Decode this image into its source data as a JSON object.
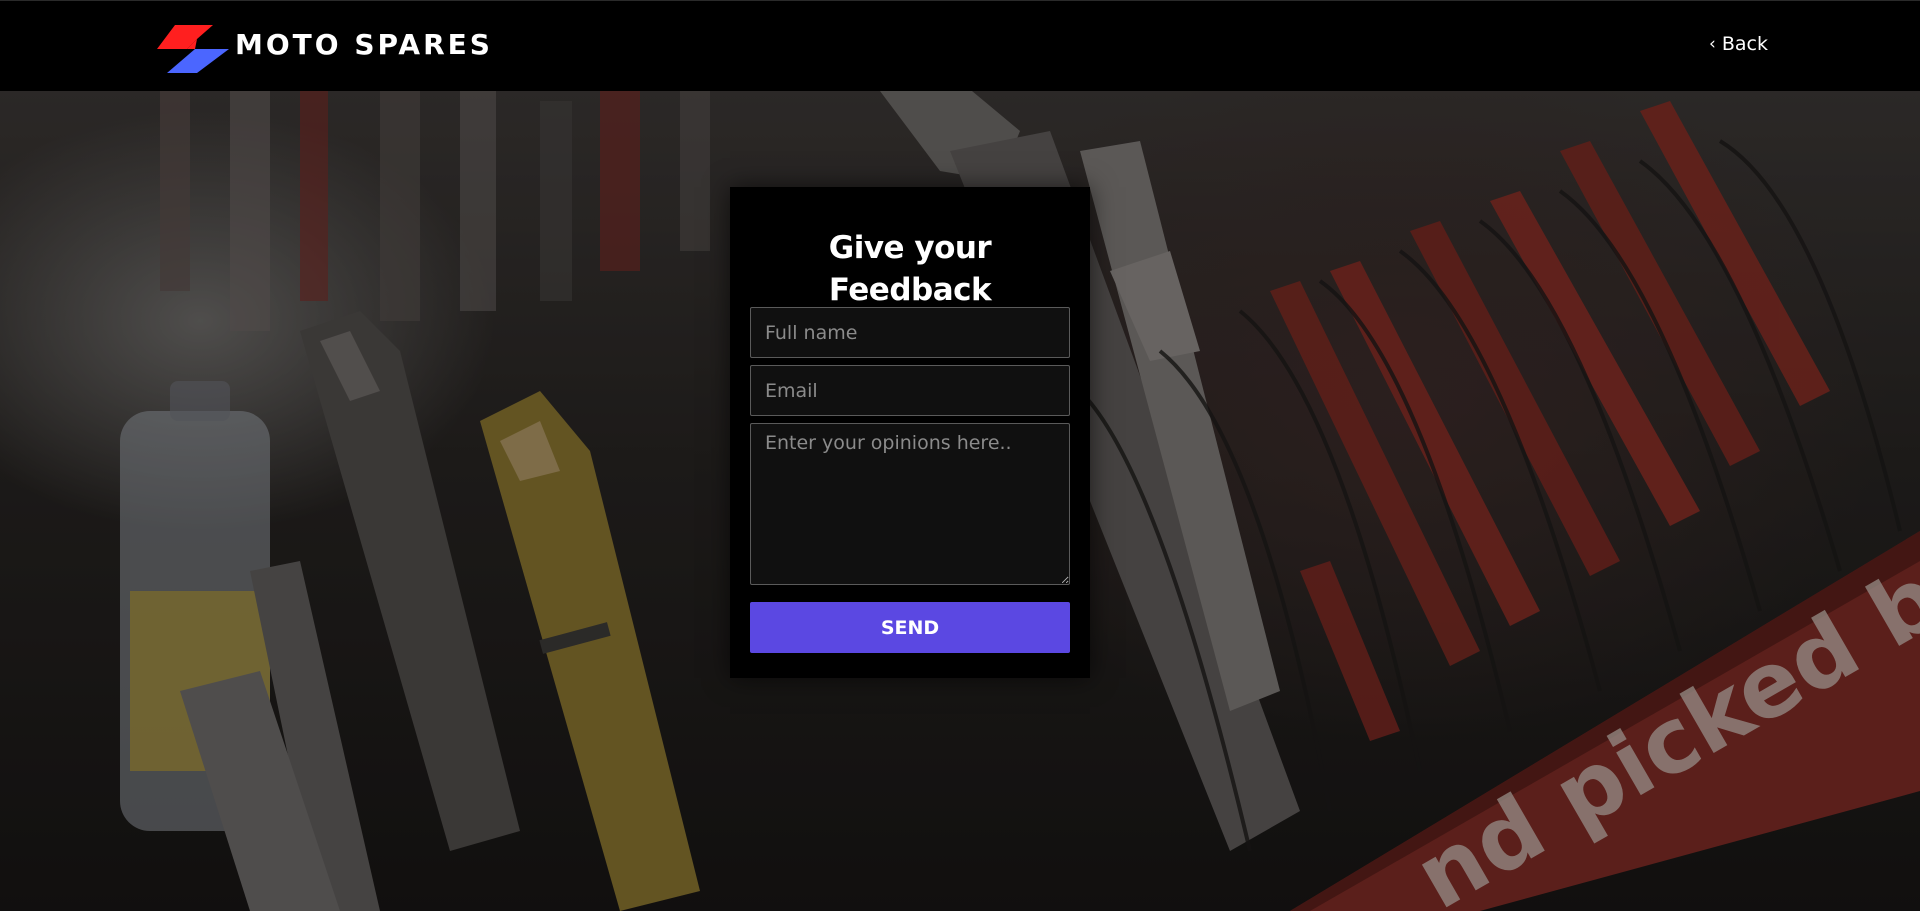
{
  "header": {
    "brand_name": "MOTO SPARES",
    "back_label": "Back",
    "back_icon": "chevron-left-icon"
  },
  "brand_colors": {
    "logo_top": "#ff1f1f",
    "logo_bottom": "#4b66ff",
    "accent": "#5b48e2"
  },
  "feedback": {
    "title": "Give your Feedback",
    "name_placeholder": "Full name",
    "email_placeholder": "Email",
    "message_placeholder": "Enter your opinions here..",
    "name_value": "",
    "email_value": "",
    "message_value": "",
    "send_label": "SEND"
  },
  "background": {
    "sign_text": "nd picked by the"
  }
}
